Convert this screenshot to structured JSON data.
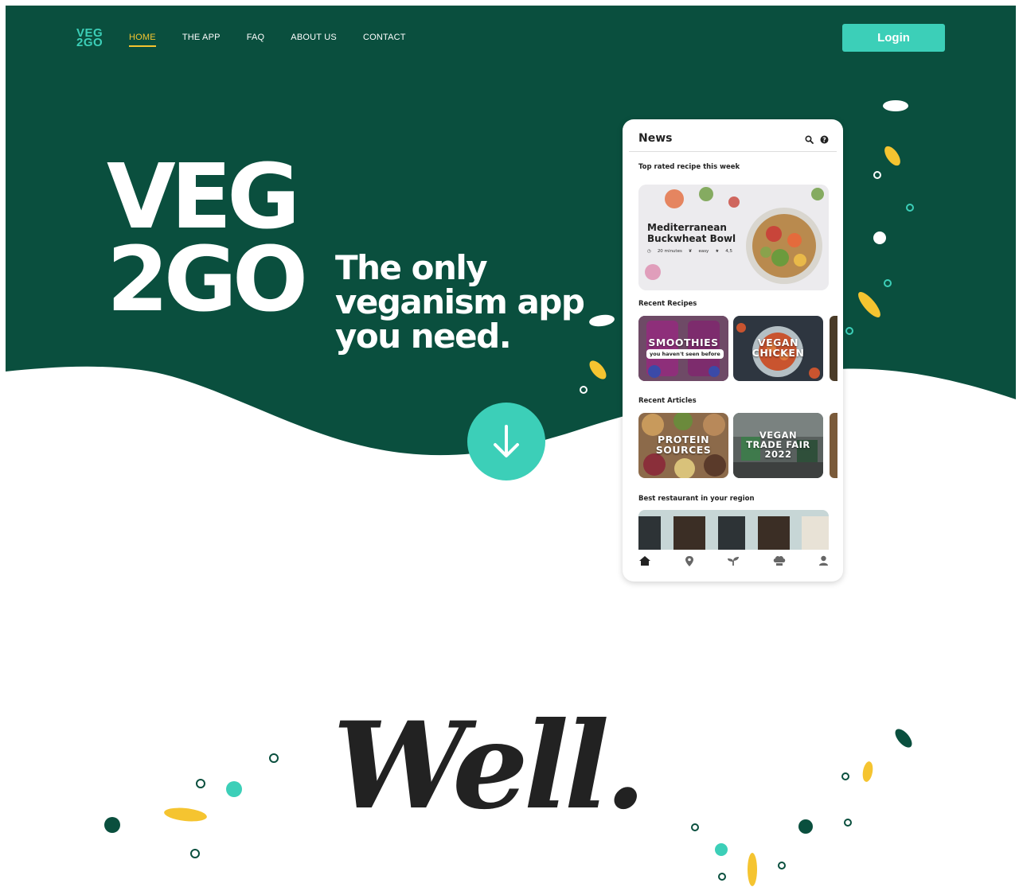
{
  "brand": {
    "logo_line1": "VEG",
    "logo_line2": "2GO"
  },
  "nav": {
    "items": [
      {
        "label": "HOME",
        "active": true
      },
      {
        "label": "THE APP",
        "active": false
      },
      {
        "label": "FAQ",
        "active": false
      },
      {
        "label": "ABOUT US",
        "active": false
      },
      {
        "label": "CONTACT",
        "active": false
      }
    ],
    "login_label": "Login"
  },
  "hero": {
    "title_line1": "VEG",
    "title_line2": "2GO",
    "tagline_line1": "The only",
    "tagline_line2": "veganism app",
    "tagline_line3": "you need.",
    "scroll_icon": "arrow-down-icon"
  },
  "phone": {
    "header": "News",
    "header_icons": [
      "search-icon",
      "help-icon"
    ],
    "top_rated_heading": "Top rated recipe this week",
    "featured": {
      "title_line1": "Mediterranean",
      "title_line2": "Buckwheat Bowl",
      "time": "20 minutes",
      "difficulty": "easy",
      "rating": "4,5"
    },
    "recent_recipes_heading": "Recent Recipes",
    "recipes": [
      {
        "line1": "SMOOTHIES",
        "subtitle": "you haven't seen before"
      },
      {
        "line1": "VEGAN",
        "line2": "CHICKEN"
      }
    ],
    "recent_articles_heading": "Recent Articles",
    "articles": [
      {
        "line1": "PROTEIN",
        "line2": "SOURCES"
      },
      {
        "line1": "VEGAN",
        "line2": "TRADE FAIR",
        "line3": "2022"
      }
    ],
    "restaurant_heading": "Best restaurant in your region",
    "tab_icons": [
      "home-icon",
      "location-pin-icon",
      "sprout-icon",
      "chef-hat-icon",
      "user-icon"
    ]
  },
  "section2": {
    "script_text": "Well..."
  },
  "colors": {
    "dark_green": "#0a4f3e",
    "teal": "#3ccfb8",
    "yellow": "#f5c430",
    "white": "#ffffff",
    "text_dark": "#222222"
  }
}
